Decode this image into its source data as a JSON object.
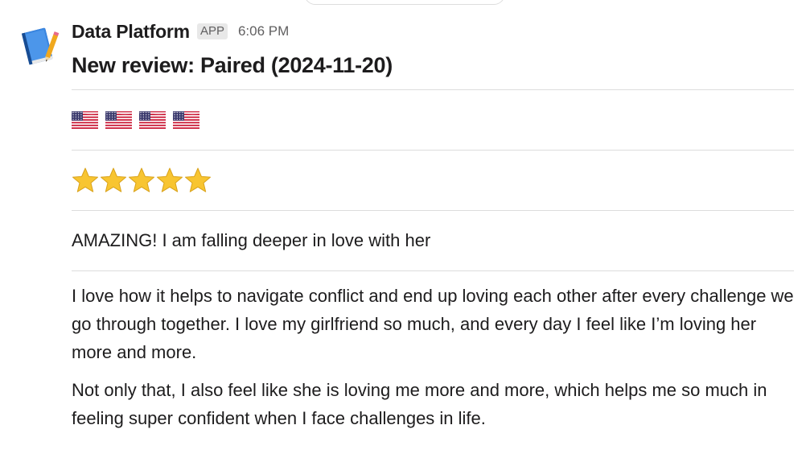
{
  "message": {
    "sender": "Data Platform",
    "badge": "APP",
    "timestamp": "6:06 PM",
    "avatar_icon": "blue-book-icon",
    "title": "New review: Paired (2024-11-20)",
    "flags": [
      "us-flag-icon",
      "us-flag-icon",
      "us-flag-icon",
      "us-flag-icon"
    ],
    "rating": 5,
    "rating_max": 5,
    "short_review": "AMAZING! I am falling deeper in love with her",
    "body_paragraphs": [
      "I love how it helps to navigate conflict and end up loving each other after every challenge we go through together. I love my girlfriend so much, and every day I feel like I’m loving her more and more.",
      "Not only that, I also feel like she is loving me more and more, which helps me so much in feeling super confident when I face challenges in life."
    ]
  },
  "colors": {
    "text": "#1d1c1d",
    "muted": "#616061",
    "divider": "#dddddd",
    "star": "#f8c531",
    "flag_red": "#c8102e",
    "flag_blue": "#3c3b6e"
  }
}
